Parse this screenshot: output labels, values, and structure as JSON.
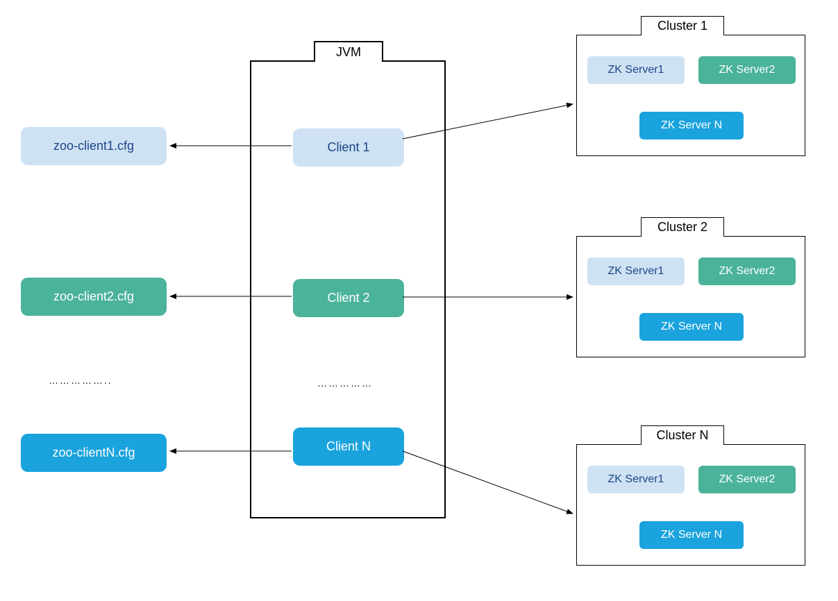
{
  "jvm": {
    "label": "JVM",
    "clients": [
      {
        "label": "Client 1",
        "color": "blue-light"
      },
      {
        "label": "Client 2",
        "color": "green"
      },
      {
        "label": "Client N",
        "color": "blue-bright"
      }
    ],
    "dots": "……………"
  },
  "configs": [
    {
      "label": "zoo-client1.cfg",
      "color": "blue-light"
    },
    {
      "label": "zoo-client2.cfg",
      "color": "green"
    },
    {
      "label": "zoo-clientN.cfg",
      "color": "blue-bright"
    }
  ],
  "configs_dots": "……………..",
  "clusters": [
    {
      "label": "Cluster 1",
      "servers": [
        {
          "label": "ZK Server1",
          "color": "blue-light"
        },
        {
          "label": "ZK Server2",
          "color": "green"
        },
        {
          "label": "ZK Server N",
          "color": "blue-bright"
        }
      ]
    },
    {
      "label": "Cluster 2",
      "servers": [
        {
          "label": "ZK Server1",
          "color": "blue-light"
        },
        {
          "label": "ZK Server2",
          "color": "green"
        },
        {
          "label": "ZK Server N",
          "color": "blue-bright"
        }
      ]
    },
    {
      "label": "Cluster N",
      "servers": [
        {
          "label": "ZK Server1",
          "color": "blue-light"
        },
        {
          "label": "ZK Server2",
          "color": "green"
        },
        {
          "label": "ZK Server N",
          "color": "blue-bright"
        }
      ]
    }
  ]
}
